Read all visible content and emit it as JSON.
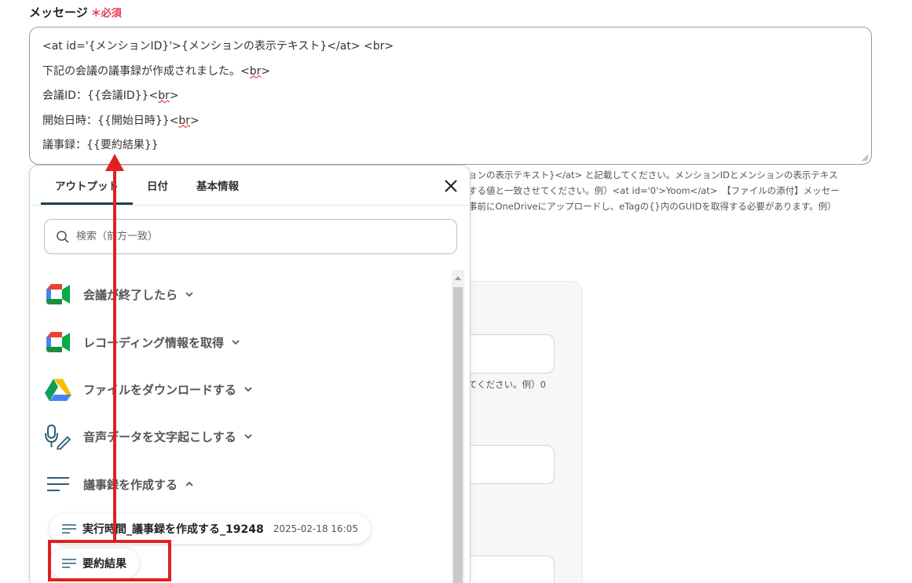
{
  "field": {
    "label": "メッセージ",
    "required": "＊必須"
  },
  "message": {
    "lines": [
      "<at id='{メンションID}'>{メンションの表示テキスト}</at> <br>",
      "下記の会議の議事録が作成されました。",
      "会議ID：{{会議ID}}",
      "開始日時：{{開始日時}}",
      "議事録：{{要約結果}}"
    ],
    "br_tag": "<br>",
    "br_open": "<",
    "br_word": "br",
    "br_close": ">"
  },
  "help_text": {
    "line1": "ョンの表示テキスト}</at> と記載してください。メンションIDとメンションの表示テキス",
    "line2": "する値と一致させてください。例）<at id='0'>Yoom</at>　【ファイルの添付】メッセー",
    "line3": "事前にOneDriveにアップロードし、eTagの{}内のGUIDを取得する必要があります。例）",
    "hint2": "てください。例）0"
  },
  "panel": {
    "tabs": [
      "アウトプット",
      "日付",
      "基本情報"
    ],
    "search_placeholder": "検索（前方一致）",
    "groups": [
      {
        "label": "会議が終了したら",
        "icon": "google-meet-icon",
        "state": "collapsed"
      },
      {
        "label": "レコーディング情報を取得",
        "icon": "google-meet-icon",
        "state": "collapsed"
      },
      {
        "label": "ファイルをダウンロードする",
        "icon": "google-drive-icon",
        "state": "collapsed"
      },
      {
        "label": "音声データを文字起こしする",
        "icon": "microphone-icon",
        "state": "collapsed"
      },
      {
        "label": "議事録を作成する",
        "icon": "text-lines-icon",
        "state": "expanded"
      }
    ],
    "items": [
      {
        "label": "実行時間_議事録を作成する_19248",
        "date": "2025-02-18 16:05"
      },
      {
        "label": "要約結果",
        "date": ""
      }
    ]
  },
  "colors": {
    "accent": "#1c3f57",
    "required": "#e23d4d",
    "annotation": "#e02020"
  }
}
